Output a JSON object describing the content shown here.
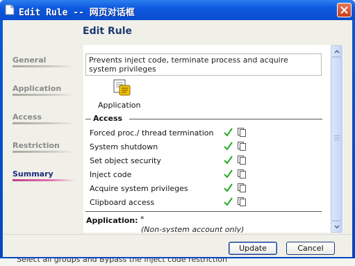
{
  "window": {
    "title": "Edit Rule -- 网页对话框"
  },
  "dialog": {
    "header_title": "Edit Rule"
  },
  "nav": {
    "items": [
      {
        "label": "General",
        "active": false
      },
      {
        "label": "Application",
        "active": false
      },
      {
        "label": "Access",
        "active": false
      },
      {
        "label": "Restriction",
        "active": false
      },
      {
        "label": "Summary",
        "active": true
      }
    ]
  },
  "summary": {
    "description": "Prevents inject code, terminate process and acquire system privileges",
    "app_icon": "application-icon",
    "app_label": "Application",
    "access_heading": "Access",
    "permissions": [
      {
        "label": "Forced proc./ thread termination",
        "allowed": true
      },
      {
        "label": "System shutdown",
        "allowed": true
      },
      {
        "label": "Set object security",
        "allowed": true
      },
      {
        "label": "Inject code",
        "allowed": true
      },
      {
        "label": "Acquire system privileges",
        "allowed": true
      },
      {
        "label": "Clipboard access",
        "allowed": true
      }
    ],
    "application_label": "Application:",
    "application_value": "*",
    "application_note": "(Non-system account only)"
  },
  "buttons": {
    "update": "Update",
    "cancel": "Cancel"
  },
  "background_text": "Select all groups and Bypass the inject code restriction",
  "colors": {
    "title_bar": "#0a4ccf",
    "header_text": "#1f3a70",
    "active_nav": "#c83c8c",
    "check": "#22aa22"
  }
}
